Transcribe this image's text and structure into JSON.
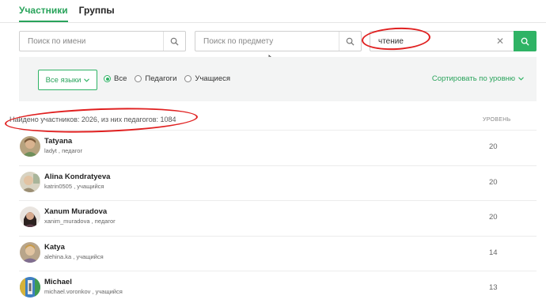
{
  "tabs": [
    {
      "label": "Участники"
    },
    {
      "label": "Группы"
    }
  ],
  "search": {
    "name_placeholder": "Поиск по имени",
    "subject_placeholder": "Поиск по предмету",
    "query_value": "чтение"
  },
  "filters": {
    "languages_label": "Все языки",
    "radios": [
      {
        "label": "Все",
        "selected": true
      },
      {
        "label": "Педагоги",
        "selected": false
      },
      {
        "label": "Учащиеся",
        "selected": false
      }
    ],
    "sort_label": "Сортировать по уровню"
  },
  "results": {
    "found_text": "Найдено участников: 2026, из них педагогов: 1084",
    "level_header": "УРОВЕНЬ"
  },
  "members": [
    {
      "name": "Tatyana",
      "sub": "ladyt , педагог",
      "level": "20"
    },
    {
      "name": "Alina Kondratyeva",
      "sub": "katrin0505 , учащийся",
      "level": "20"
    },
    {
      "name": "Xanum Muradova",
      "sub": "xanim_muradova , педагог",
      "level": "20"
    },
    {
      "name": "Katya",
      "sub": "alehina.ka , учащийся",
      "level": "14"
    },
    {
      "name": "Michael",
      "sub": "michael.voronkov , учащийся",
      "level": "13"
    }
  ],
  "colors": {
    "accent": "#2fb365",
    "annotation": "#e02020",
    "panel_bg": "#f3f4f4"
  }
}
